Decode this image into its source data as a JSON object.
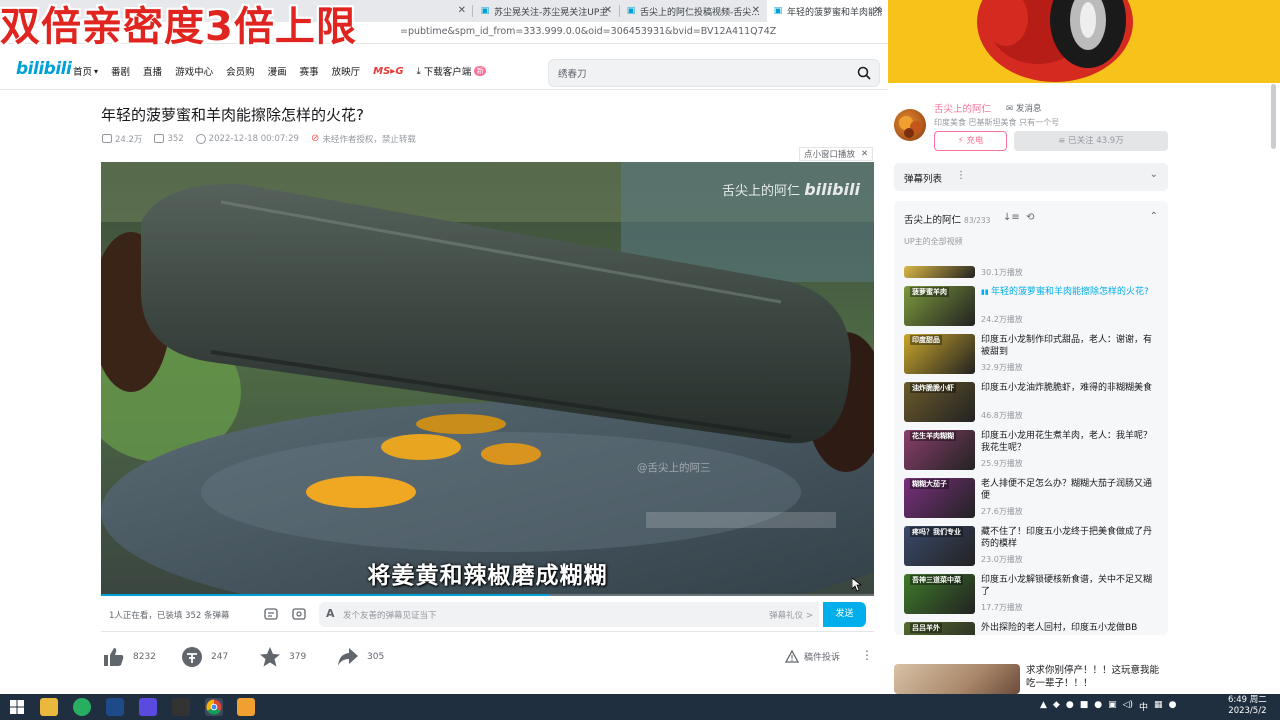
{
  "browser": {
    "tabs": [
      {
        "title": "苏尘晃关注-苏尘晃关注UP主",
        "active": false
      },
      {
        "title": "舌尖上的阿仁投稿视频-舌尖...",
        "active": false
      },
      {
        "title": "年轻的菠萝蜜和羊肉能擦除...",
        "active": true
      }
    ],
    "url_fragment": "=pubtime&spm_id_from=333.999.0.0&oid=306453931&bvid=BV12A411Q74Z"
  },
  "overlay_banner": "双倍亲密度3倍上限",
  "header": {
    "logo": "bilibili",
    "nav": [
      "首页",
      "番剧",
      "直播",
      "游戏中心",
      "会员购",
      "漫画",
      "赛事",
      "放映厅",
      "MS▸G",
      "下载客户端"
    ],
    "nav_badge": "新",
    "search_placeholder": "绣春刀"
  },
  "video": {
    "title": "年轻的菠萝蜜和羊肉能擦除怎样的火花?",
    "views": "24.2万",
    "danmaku_count": "352",
    "date": "2022-12-18 00:07:29",
    "copyright": "未经作者授权，禁止转载",
    "mini_window": "点小窗口播放",
    "subtitle": "将姜黄和辣椒磨成糊糊",
    "watermark": "舌尖上的阿仁",
    "watermark_logo": "bilibili",
    "watermark_small": "@舌尖上的阿三",
    "progress": 0.58
  },
  "danmaku_bar": {
    "viewers": "1人正在看，已装填 352 条弹幕",
    "placeholder": "发个友善的弹幕见证当下",
    "etiquette": "弹幕礼仪 >",
    "send": "发送"
  },
  "toolbar": {
    "likes": "8232",
    "coins": "247",
    "favorites": "379",
    "shares": "305",
    "report": "稿件投诉"
  },
  "uploader": {
    "name": "舌尖上的阿仁",
    "message": "发消息",
    "description": "印度美食 巴基斯坦美食 只有一个号",
    "charge": "⚡ 充电",
    "follow": "≡ 已关注 43.9万"
  },
  "danmaku_list": {
    "title": "弹幕列表"
  },
  "playlist": {
    "title": "舌尖上的阿仁",
    "count": "83/233",
    "subtitle": "UP主的全部视频",
    "items": [
      {
        "thumb_label": "",
        "title": "",
        "views": "30.1万播放",
        "active": false,
        "color": "#d9b845"
      },
      {
        "thumb_label": "菠萝蜜羊肉",
        "title": "年轻的菠萝蜜和羊肉能擦除怎样的火花?",
        "views": "24.2万播放",
        "active": true,
        "color": "#7c9a3c"
      },
      {
        "thumb_label": "印度甜品",
        "title": "印度五小龙制作印式甜品，老人：谢谢，有被甜到",
        "views": "32.9万播放",
        "active": false,
        "color": "#c9a62b"
      },
      {
        "thumb_label": "油炸脆脆小虾",
        "title": "印度五小龙油炸脆脆虾，难得的非糊糊美食",
        "views": "46.8万播放",
        "active": false,
        "color": "#6b5a2b"
      },
      {
        "thumb_label": "花生羊肉糊糊",
        "title": "印度五小龙用花生煮羊肉，老人：我羊呢？我花生呢？",
        "views": "25.9万播放",
        "active": false,
        "color": "#8a3f6c"
      },
      {
        "thumb_label": "糊糊大茄子",
        "title": "老人排便不足怎么办？糊糊大茄子润肠又通便",
        "views": "27.6万播放",
        "active": false,
        "color": "#7a2f7e"
      },
      {
        "thumb_label": "疼吗？我们专业",
        "title": "藏不住了！印度五小龙终于把美食做成了丹药的模样",
        "views": "23.0万播放",
        "active": false,
        "color": "#3a4a6a"
      },
      {
        "thumb_label": "吾神三道菜中菜",
        "title": "印度五小龙解锁硬核新食谱，关中不足又糊了",
        "views": "17.7万播放",
        "active": false,
        "color": "#3f7a2a"
      },
      {
        "thumb_label": "吕吕羊外",
        "title": "外出探险的老人回村，印度五小龙做BB",
        "views": "",
        "active": false,
        "color": "#556b2f"
      }
    ]
  },
  "recommend": {
    "title": "求求你别停产！！！这玩意我能吃一辈子！！！"
  },
  "taskbar": {
    "clock_time": "6:49 周二",
    "clock_date": "2023/5/2",
    "tray_lang": "中"
  }
}
